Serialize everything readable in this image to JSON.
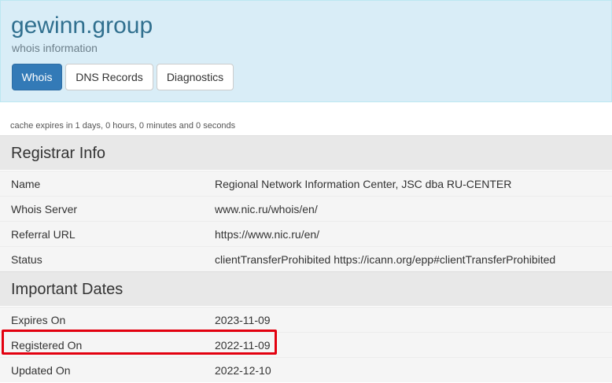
{
  "header": {
    "domain": "gewinn.group",
    "subtitle": "whois information",
    "tabs": [
      {
        "label": "Whois",
        "active": true
      },
      {
        "label": "DNS Records",
        "active": false
      },
      {
        "label": "Diagnostics",
        "active": false
      }
    ]
  },
  "cache_note": "cache expires in 1 days, 0 hours, 0 minutes and 0 seconds",
  "registrar": {
    "title": "Registrar Info",
    "rows": [
      {
        "label": "Name",
        "value": "Regional Network Information Center, JSC dba RU-CENTER"
      },
      {
        "label": "Whois Server",
        "value": "www.nic.ru/whois/en/"
      },
      {
        "label": "Referral URL",
        "value": "https://www.nic.ru/en/"
      },
      {
        "label": "Status",
        "value": "clientTransferProhibited https://icann.org/epp#clientTransferProhibited"
      }
    ]
  },
  "dates": {
    "title": "Important Dates",
    "rows": [
      {
        "label": "Expires On",
        "value": "2023-11-09"
      },
      {
        "label": "Registered On",
        "value": "2022-11-09"
      },
      {
        "label": "Updated On",
        "value": "2022-12-10"
      }
    ]
  },
  "colors": {
    "header_bg": "#d9edf7",
    "title_color": "#31708f",
    "active_tab": "#337ab7",
    "highlight_box": "#e3000f"
  }
}
